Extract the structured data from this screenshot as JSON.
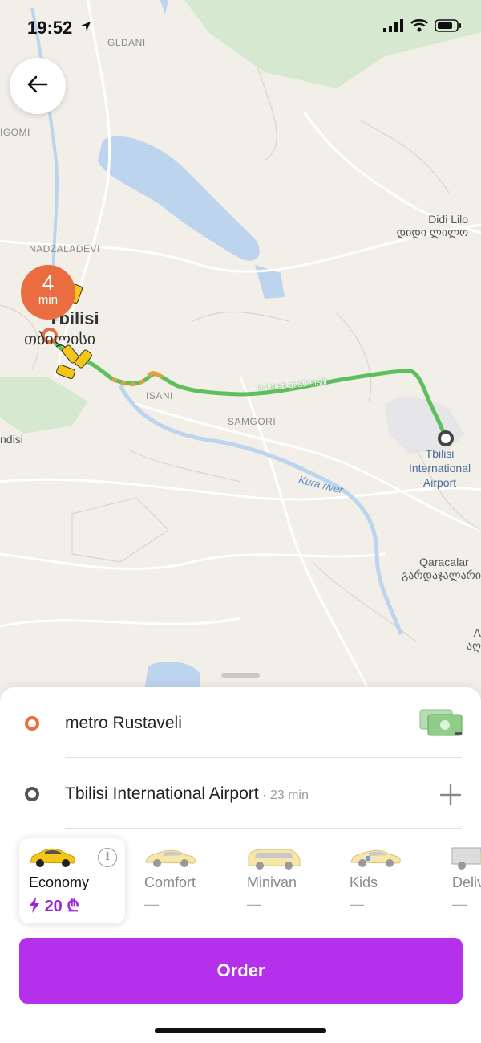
{
  "status_bar": {
    "time": "19:52"
  },
  "map": {
    "districts": {
      "gldani": "GLDANI",
      "digomi": "IGOMI",
      "nadzaladevi": "NADZALADEVI",
      "isani": "ISANI",
      "samgori": "SAMGORI",
      "left_edge": "ndisi"
    },
    "city": {
      "name": "Tbilisi",
      "name_local": "თბილისი"
    },
    "towns": {
      "didi_lilo": {
        "name": "Didi Lilo",
        "name_local": "დიდი ლილო"
      },
      "qaracalar": {
        "name": "Qaracalar",
        "name_local": "გარდაჯალარი"
      },
      "edge_a": {
        "name": "A",
        "name_local": "აღ"
      }
    },
    "airport": {
      "line1": "Tbilisi",
      "line2": "International",
      "line3": "Airport"
    },
    "river": "Kura river",
    "road": "Kakheti gzatketsili",
    "eta": {
      "value": "4",
      "unit": "min"
    }
  },
  "route": {
    "from": {
      "label": "metro Rustaveli"
    },
    "to": {
      "label": "Tbilisi International Airport",
      "duration": " · 23 min"
    }
  },
  "tariffs": [
    {
      "name": "Economy",
      "price": "20 ₾",
      "selected": true
    },
    {
      "name": "Comfort",
      "price": "—",
      "selected": false
    },
    {
      "name": "Minivan",
      "price": "—",
      "selected": false
    },
    {
      "name": "Kids",
      "price": "—",
      "selected": false
    },
    {
      "name": "Deliv",
      "price": "—",
      "selected": false
    }
  ],
  "order_button": {
    "label": "Order"
  },
  "colors": {
    "accent": "#b430ea",
    "route": "#5cc05c",
    "origin": "#ea6d42"
  }
}
